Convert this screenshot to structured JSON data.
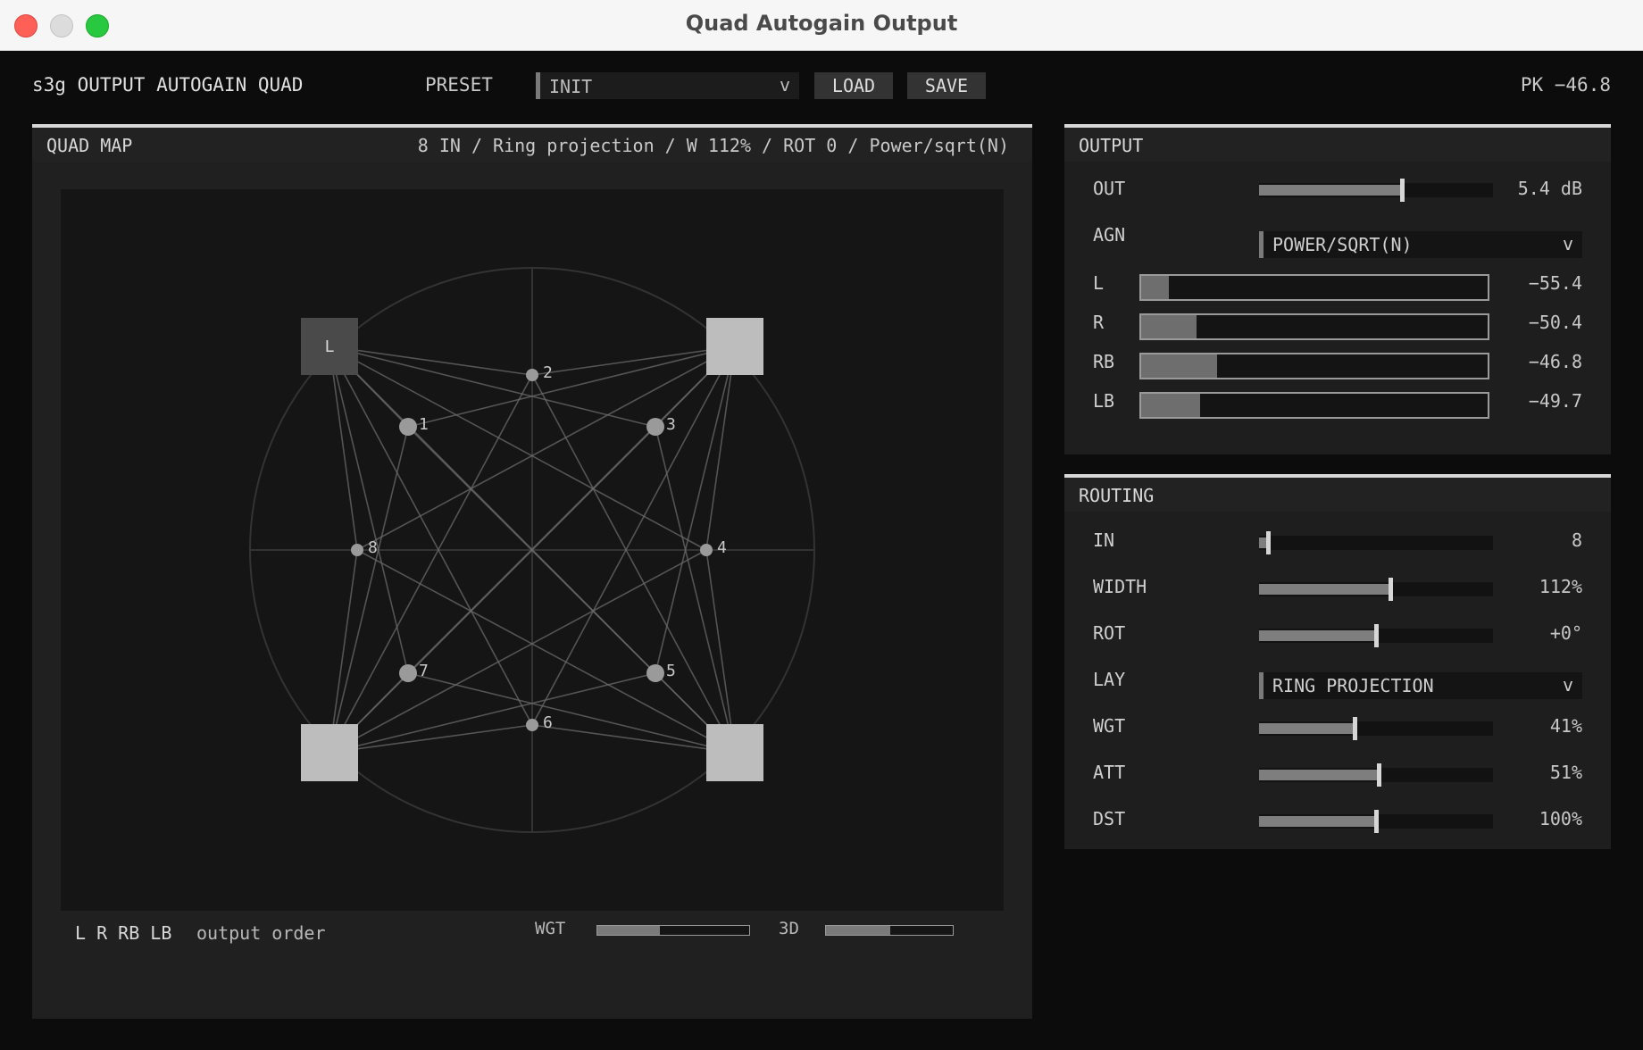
{
  "window": {
    "title": "Quad Autogain Output"
  },
  "header": {
    "title": "s3g OUTPUT AUTOGAIN QUAD",
    "preset_label": "PRESET",
    "preset_value": "INIT",
    "load_label": "LOAD",
    "save_label": "SAVE",
    "peak_readout": "PK −46.8"
  },
  "quad_map": {
    "title": "QUAD MAP",
    "status": "8 IN / Ring projection / W 112% / ROT 0 / Power/sqrt(N)",
    "speakers": [
      {
        "label": "L",
        "active": true
      },
      {
        "label": "",
        "active": false
      },
      {
        "label": "",
        "active": false
      },
      {
        "label": "",
        "active": false
      }
    ],
    "input_labels": [
      "1",
      "2",
      "3",
      "4",
      "5",
      "6",
      "7",
      "8"
    ],
    "output_order_keys": "L R RB LB",
    "output_order_label": "output order",
    "wgt_label": "WGT",
    "wgt_level": 0.41,
    "d3_label": "3D",
    "d3_level": 0.51
  },
  "output": {
    "title": "OUTPUT",
    "out_label": "OUT",
    "out_value": "5.4 dB",
    "out_level": 0.61,
    "agn_label": "AGN",
    "agn_value": "POWER/SQRT(N)",
    "meters": [
      {
        "label": "L",
        "value": "−55.4",
        "level": 0.08
      },
      {
        "label": "R",
        "value": "−50.4",
        "level": 0.16
      },
      {
        "label": "RB",
        "value": "−46.8",
        "level": 0.22
      },
      {
        "label": "LB",
        "value": "−49.7",
        "level": 0.17
      }
    ]
  },
  "routing": {
    "title": "ROUTING",
    "in_label": "IN",
    "in_value": "8",
    "in_level": 0.04,
    "width_label": "WIDTH",
    "width_value": "112%",
    "width_level": 0.56,
    "rot_label": "ROT",
    "rot_value": "+0°",
    "rot_level": 0.5,
    "lay_label": "LAY",
    "lay_value": "RING PROJECTION",
    "wgt_label": "WGT",
    "wgt_value": "41%",
    "wgt_level": 0.41,
    "att_label": "ATT",
    "att_value": "51%",
    "att_level": 0.51,
    "dst_label": "DST",
    "dst_value": "100%",
    "dst_level": 0.5
  },
  "colors": {
    "speaker_active": "#4a4a4a",
    "speaker": "#bdbdbd",
    "node": "#9a9a9a",
    "line": "#6a6a6a",
    "grid": "#333333"
  },
  "icons": {
    "dropdown": "chevron-down-icon"
  }
}
